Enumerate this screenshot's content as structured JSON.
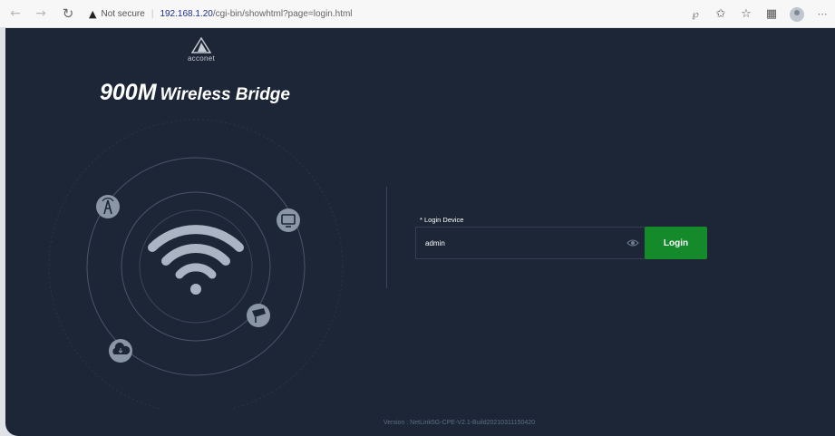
{
  "browser": {
    "security_icon": "warning-triangle-icon",
    "security_label": "Not secure",
    "url_host": "192.168.1.20",
    "url_path": "/cgi-bin/showhtml?page=login.html",
    "toolbar_icons": [
      "back-arrow-icon",
      "forward-arrow-icon",
      "reload-icon",
      "read-aloud-icon",
      "tracking-icon",
      "favorites-icon",
      "collections-icon",
      "profile-icon",
      "more-icon"
    ]
  },
  "brand": {
    "logo_text": "acconet",
    "title_main": "900M",
    "title_sub": "Wireless Bridge"
  },
  "illustration": {
    "icons": [
      "antenna-tower-icon",
      "monitor-icon",
      "camera-icon",
      "cloud-icon",
      "wifi-icon"
    ]
  },
  "login": {
    "label": "* Login Device",
    "password_value": "admin",
    "button_label": "Login"
  },
  "footer": {
    "version": "Version : NetLink5G-CPE-V2.1-Build20210311150420"
  },
  "colors": {
    "page_background": "#1c2636",
    "login_button": "#158a2b",
    "ring": "#4a5568"
  }
}
